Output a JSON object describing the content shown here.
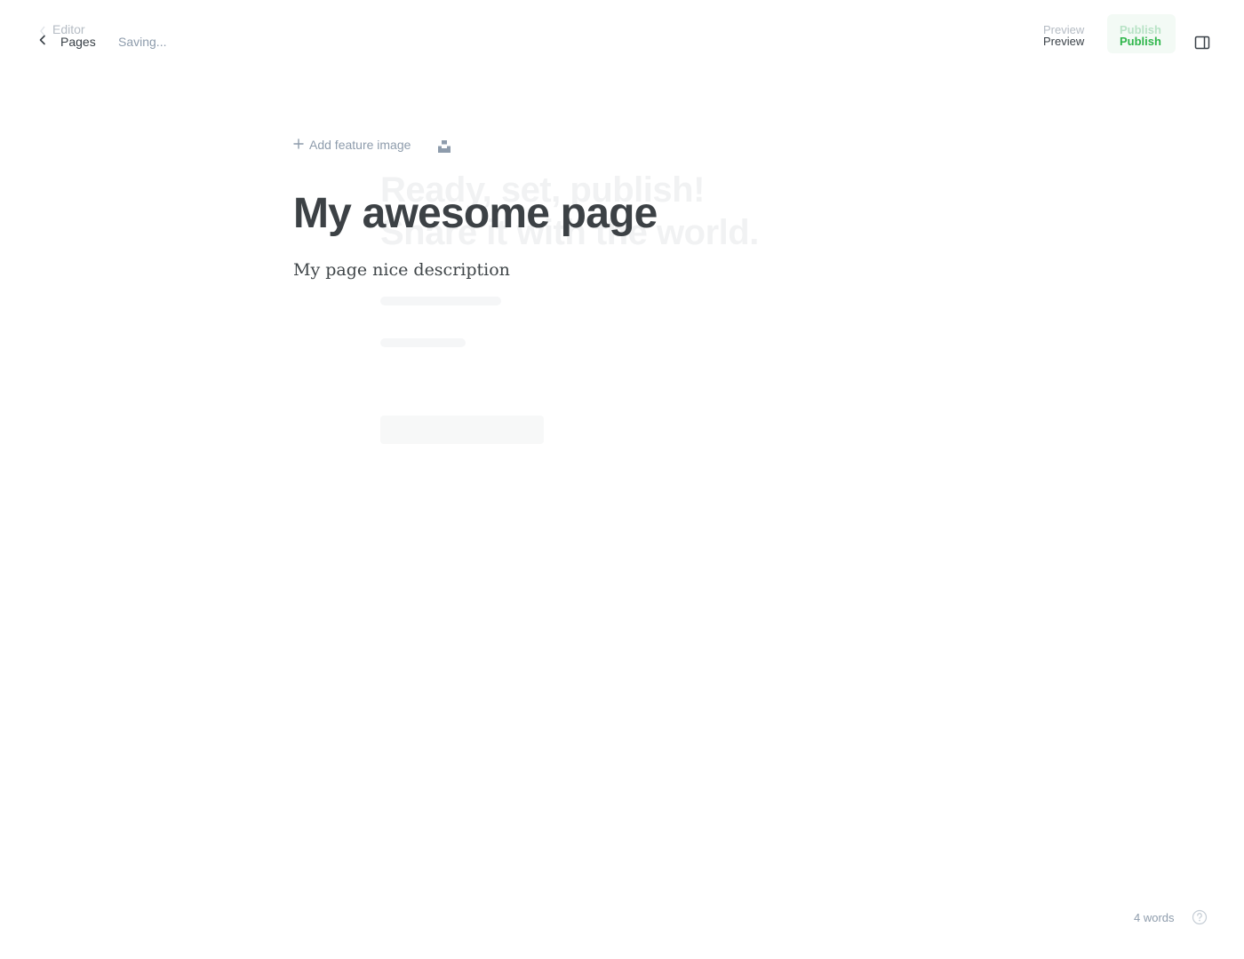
{
  "ghost": {
    "editor_label": "Editor",
    "preview_label": "Preview",
    "publish_label": "Publish",
    "heading": "Ready, set, publish! Share it with the world."
  },
  "header": {
    "back_label": "Pages",
    "save_status": "Saving...",
    "preview_label": "Preview",
    "publish_label": "Publish"
  },
  "editor": {
    "feature_image_label": "Add feature image",
    "title": "My awesome page",
    "excerpt": "My page nice description"
  },
  "footer": {
    "word_count": "4 words"
  },
  "colors": {
    "accent": "#30cf43",
    "muted": "#8e9cac",
    "text": "#394047"
  },
  "icons": {
    "back": "chevron-left-icon",
    "settings": "sidebar-toggle-icon",
    "add": "plus-icon",
    "unsplash": "unsplash-icon",
    "help": "question-circle-icon"
  }
}
